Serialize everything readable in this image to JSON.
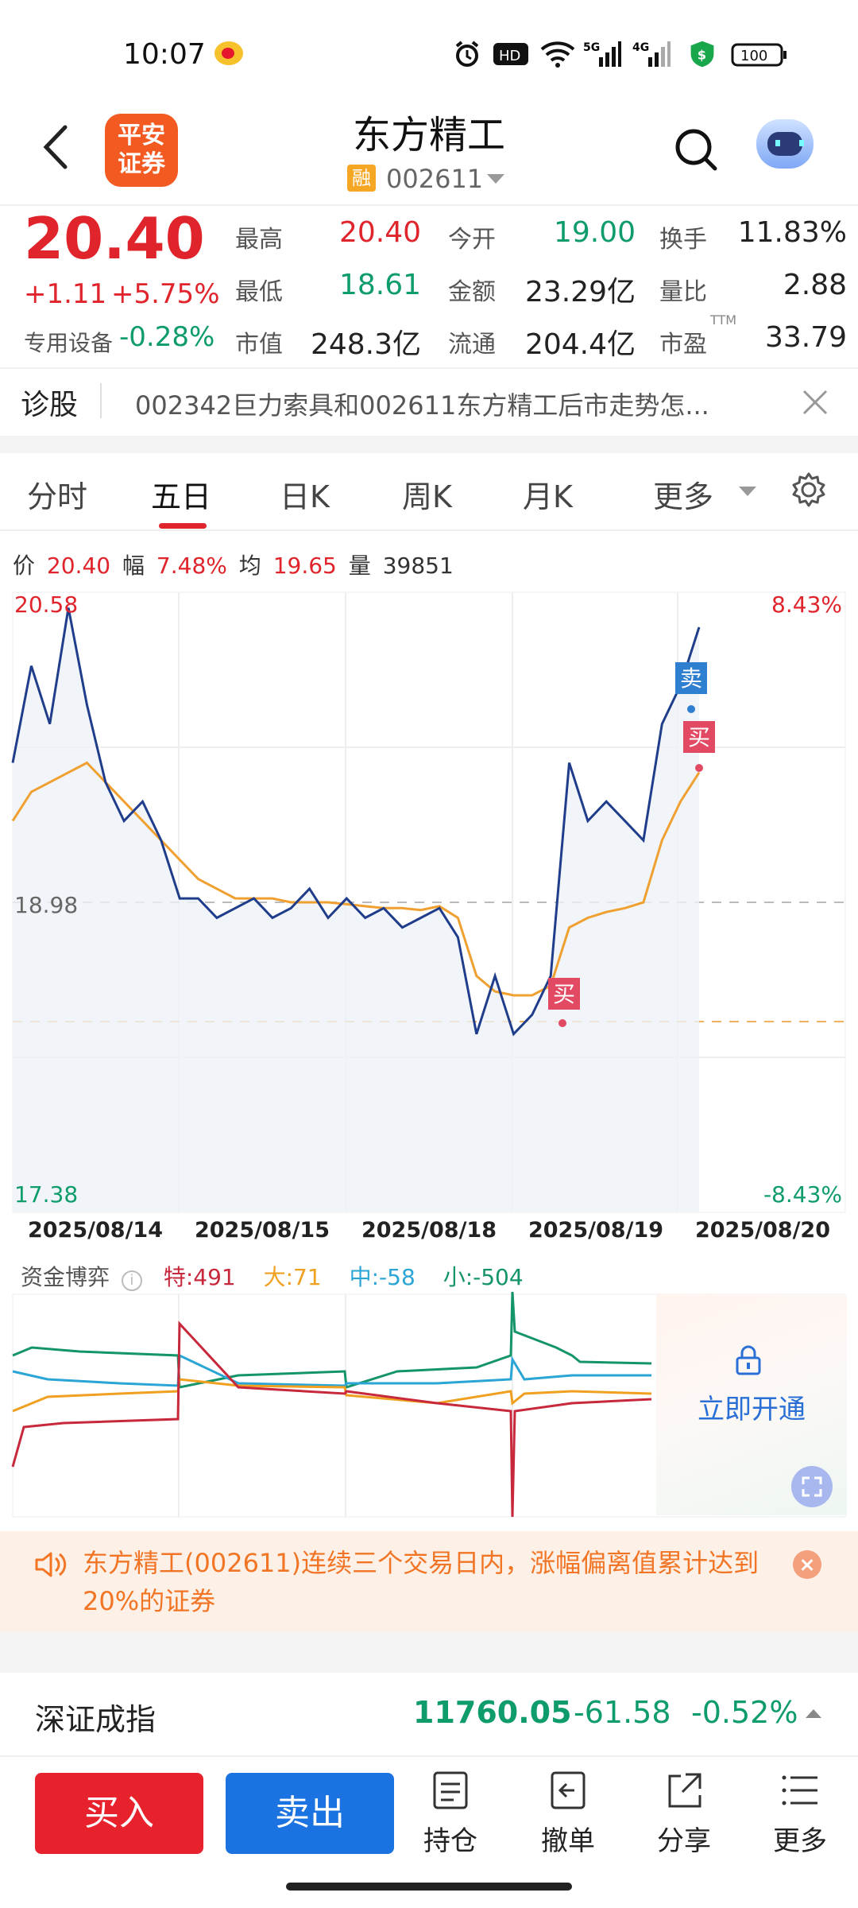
{
  "status_bar": {
    "time": "10:07",
    "battery": "100",
    "hd": "HD",
    "net1": "5G",
    "net2": "4G"
  },
  "header": {
    "broker_logo": "平安\n证券",
    "stock_name": "东方精工",
    "margin_badge": "融",
    "stock_code": "002611"
  },
  "quote": {
    "last_price": "20.40",
    "change_abs": "+1.11",
    "change_pct": "+5.75%",
    "sector_name": "专用设备",
    "sector_pct": "-0.28%",
    "fields": [
      {
        "label": "最高",
        "value": "20.40",
        "color": "#e0242c"
      },
      {
        "label": "今开",
        "value": "19.00",
        "color": "#0e9c6a"
      },
      {
        "label": "换手",
        "value": "11.83%",
        "color": "#222222"
      },
      {
        "label": "最低",
        "value": "18.61",
        "color": "#0e9c6a"
      },
      {
        "label": "金额",
        "value": "23.29亿",
        "color": "#222222"
      },
      {
        "label": "量比",
        "value": "2.88",
        "color": "#222222"
      },
      {
        "label": "市值",
        "value": "248.3亿",
        "color": "#222222"
      },
      {
        "label": "流通",
        "value": "204.4亿",
        "color": "#222222"
      },
      {
        "label": "市盈",
        "value": "33.79",
        "color": "#222222"
      }
    ],
    "ttm": "TTM"
  },
  "diagnose": {
    "label": "诊股",
    "text": "002342巨力索具和002611东方精工后市走势怎..."
  },
  "tabs": [
    "分时",
    "五日",
    "日K",
    "周K",
    "月K",
    "更多"
  ],
  "active_tab": "五日",
  "info_row": {
    "price_label": "价",
    "price": "20.40",
    "range_label": "幅",
    "range": "7.48%",
    "avg_label": "均",
    "avg": "19.65",
    "vol_label": "量",
    "vol": "39851"
  },
  "chart_data": {
    "type": "line",
    "title": "",
    "x": [
      "2025/08/14",
      "2025/08/15",
      "2025/08/18",
      "2025/08/19",
      "2025/08/20"
    ],
    "y_axis_left": {
      "max": "20.58",
      "ref": "18.98",
      "min": "17.38"
    },
    "y_axis_right": {
      "max": "8.43%",
      "min": "-8.43%"
    },
    "ylim": [
      17.38,
      20.58
    ],
    "prev_close": 18.98,
    "series": [
      {
        "color": "#1f3d8a",
        "values": [
          19.7,
          20.2,
          19.9,
          20.5,
          20.0,
          19.6,
          19.4,
          19.5,
          19.3,
          19.0,
          19.0,
          18.9,
          18.95,
          19.0,
          18.9,
          18.95,
          19.05,
          18.9,
          19.0,
          18.9,
          18.95,
          18.85,
          18.9,
          18.95,
          18.8,
          18.3,
          18.6,
          18.3,
          18.4,
          18.6,
          19.7,
          19.4,
          19.5,
          19.4,
          19.3,
          19.9,
          20.1,
          20.4
        ]
      },
      {
        "color": "#f0a030",
        "values": [
          19.4,
          19.55,
          19.6,
          19.65,
          19.7,
          19.6,
          19.5,
          19.4,
          19.3,
          19.2,
          19.1,
          19.05,
          19.0,
          19.0,
          19.0,
          18.98,
          18.98,
          18.98,
          18.97,
          18.96,
          18.95,
          18.95,
          18.94,
          18.96,
          18.9,
          18.6,
          18.52,
          18.5,
          18.5,
          18.55,
          18.85,
          18.9,
          18.93,
          18.95,
          18.98,
          19.3,
          19.5,
          19.65
        ]
      }
    ],
    "markers": [
      {
        "label": "卖",
        "color": "#2f7fd0"
      },
      {
        "label": "买",
        "color": "#e24a63"
      },
      {
        "label": "买",
        "color": "#e24a63"
      }
    ]
  },
  "fund_flow": {
    "label": "资金博弈",
    "items": [
      {
        "text": "特:491",
        "color": "#c8283c"
      },
      {
        "text": "大:71",
        "color": "#f0a020"
      },
      {
        "text": "中:-58",
        "color": "#2aa5d5"
      },
      {
        "text": "小:-504",
        "color": "#14946a"
      }
    ],
    "unlock_text": "立即开通"
  },
  "alert": {
    "text": "东方精工(002611)连续三个交易日内，涨幅偏离值累计达到20%的证券"
  },
  "index": {
    "name": "深证成指",
    "value": "11760.05",
    "change": "-61.58",
    "pct": "-0.52%"
  },
  "bottom_bar": {
    "buy": "买入",
    "sell": "卖出",
    "hold": "持仓",
    "cancel": "撤单",
    "share": "分享",
    "more": "更多"
  }
}
